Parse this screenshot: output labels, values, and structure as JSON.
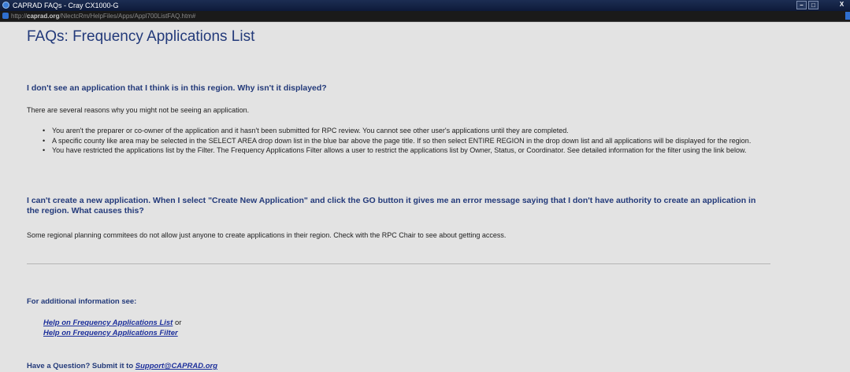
{
  "window": {
    "title": "CAPRAD FAQs - Cray CX1000-G",
    "url_prefix": "http://",
    "url_domain": "caprad.org",
    "url_path": "/NlectcRm/HelpFiles/Apps/Appl700ListFAQ.htm#",
    "buttons": [
      "–",
      "□",
      "X"
    ]
  },
  "page": {
    "title": "FAQs: Frequency Applications List",
    "q1": "I don't see an application that I think is in this region. Why isn't it displayed?",
    "intro": "There are several reasons why you might not be seeing an application.",
    "bullets": [
      "You aren't the preparer or co-owner of the application and it hasn't been submitted for RPC review. You cannot see other user's applications until they are completed.",
      "A specific county like area may be selected in the SELECT AREA drop down list in the blue bar above the page title. If so then select ENTIRE REGION in the drop down list and all applications will be displayed for the region.",
      "You have restricted the applications list by the Filter. The Frequency Applications Filter allows a user to restrict the applications list by Owner, Status, or Coordinator. See detailed information for the filter using the link below."
    ],
    "q2": "I can't create a new application. When I select \"Create New Application\" and click the GO button it gives me an error message saying that I don't have authority to create an application in the region. What causes this?",
    "answer2": "Some regional planning commitees do not allow just anyone to create applications in their region. Check with the RPC Chair to see about getting access.",
    "additional_heading": "For additional information see:",
    "link1": "Help on Frequency Applications List",
    "link1_suffix": "or",
    "link2": "Help on Frequency Applications Filter",
    "question_text": "Have a Question? Submit it to",
    "support_email": "Support@CAPRAD.org"
  }
}
